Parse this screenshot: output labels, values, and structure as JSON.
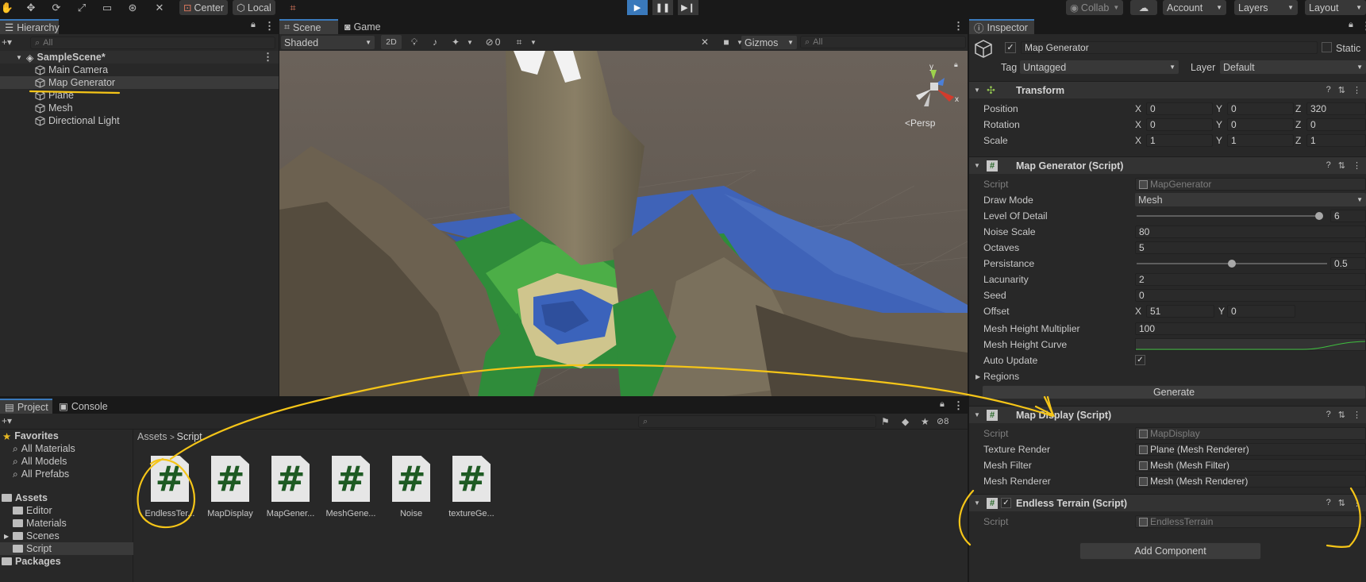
{
  "toolbar": {
    "pivot_label": "Center",
    "space_label": "Local",
    "collab_label": "Collab",
    "account_label": "Account",
    "layers_label": "Layers",
    "layout_label": "Layout"
  },
  "hierarchy": {
    "tab_label": "Hierarchy",
    "search_placeholder": "All",
    "scene_name": "SampleScene*",
    "items": [
      {
        "label": "Main Camera",
        "selected": false
      },
      {
        "label": "Map Generator",
        "selected": true
      },
      {
        "label": "Plane",
        "selected": false
      },
      {
        "label": "Mesh",
        "selected": false
      },
      {
        "label": "Directional Light",
        "selected": false
      }
    ]
  },
  "scene": {
    "tabs": [
      "Scene",
      "Game"
    ],
    "shading_mode": "Shaded",
    "mode_2d": "2D",
    "hidden_count": "0",
    "gizmos_label": "Gizmos",
    "search_placeholder": "All",
    "projection_label": "Persp",
    "axis_x": "x",
    "axis_y": "y"
  },
  "inspector": {
    "tab_label": "Inspector",
    "object_name": "Map Generator",
    "static_label": "Static",
    "tag_label": "Tag",
    "tag_value": "Untagged",
    "layer_label": "Layer",
    "layer_value": "Default",
    "transform": {
      "title": "Transform",
      "rows": [
        {
          "label": "Position",
          "x": "0",
          "y": "0",
          "z": "320"
        },
        {
          "label": "Rotation",
          "x": "0",
          "y": "0",
          "z": "0"
        },
        {
          "label": "Scale",
          "x": "1",
          "y": "1",
          "z": "1"
        }
      ]
    },
    "map_generator": {
      "title": "Map Generator (Script)",
      "script_label": "Script",
      "script_value": "MapGenerator",
      "draw_mode_label": "Draw Mode",
      "draw_mode_value": "Mesh",
      "lod_label": "Level Of Detail",
      "lod_value": "6",
      "lod_fraction": 1.0,
      "noise_scale_label": "Noise Scale",
      "noise_scale_value": "80",
      "octaves_label": "Octaves",
      "octaves_value": "5",
      "persistance_label": "Persistance",
      "persistance_value": "0.5",
      "persistance_fraction": 0.5,
      "lacunarity_label": "Lacunarity",
      "lacunarity_value": "2",
      "seed_label": "Seed",
      "seed_value": "0",
      "offset_label": "Offset",
      "offset_x": "51",
      "offset_y": "0",
      "height_mult_label": "Mesh Height Multiplier",
      "height_mult_value": "100",
      "height_curve_label": "Mesh Height Curve",
      "auto_update_label": "Auto Update",
      "auto_update_checked": true,
      "regions_label": "Regions",
      "generate_label": "Generate"
    },
    "map_display": {
      "title": "Map Display (Script)",
      "script_label": "Script",
      "script_value": "MapDisplay",
      "texture_render_label": "Texture Render",
      "texture_render_value": "Plane (Mesh Renderer)",
      "mesh_filter_label": "Mesh Filter",
      "mesh_filter_value": "Mesh (Mesh Filter)",
      "mesh_renderer_label": "Mesh Renderer",
      "mesh_renderer_value": "Mesh (Mesh Renderer)"
    },
    "endless_terrain": {
      "title": "Endless Terrain (Script)",
      "script_label": "Script",
      "script_value": "EndlessTerrain"
    },
    "add_component_label": "Add Component"
  },
  "project": {
    "tabs": [
      "Project",
      "Console"
    ],
    "hidden_count": "8",
    "favorites_label": "Favorites",
    "favorites": [
      "All Materials",
      "All Models",
      "All Prefabs"
    ],
    "assets_label": "Assets",
    "asset_folders": [
      "Editor",
      "Materials",
      "Scenes",
      "Script"
    ],
    "packages_label": "Packages",
    "breadcrumb": [
      "Assets",
      "Script"
    ],
    "files": [
      "EndlessTer...",
      "MapDisplay",
      "MapGener...",
      "MeshGene...",
      "Noise",
      "textureGe..."
    ]
  }
}
